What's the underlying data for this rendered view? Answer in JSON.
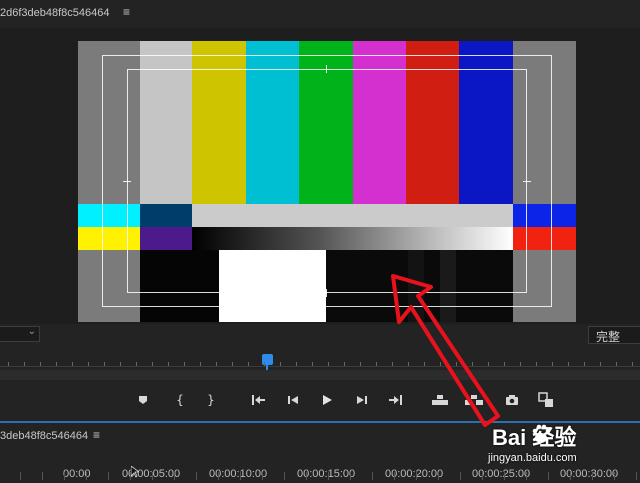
{
  "program_monitor": {
    "sequence_title": "2d6f3deb48f8c546464",
    "menu_icon": "menu-icon",
    "quality": "完整",
    "zoom_select_icon": "chevron-down-icon"
  },
  "colors": {
    "bars_top": [
      "#c5c5c5",
      "#cec400",
      "#00bfd2",
      "#00b31a",
      "#d42fcf",
      "#d01e13",
      "#0b17c4"
    ],
    "accent": "#2d8ceb",
    "annotation_arrow": "#e8121d"
  },
  "transport": {
    "buttons": [
      "add-marker-icon",
      "mark-in-icon",
      "mark-out-icon",
      "go-to-in-icon",
      "step-back-icon",
      "play-icon",
      "step-forward-icon",
      "go-to-out-icon",
      "lift-icon",
      "extract-icon",
      "export-frame-icon",
      "compare-icon"
    ]
  },
  "timeline": {
    "sequence_title": "3deb48f8c546464",
    "timecodes": [
      "00:00",
      "00:00:05:00",
      "00:00:10:00",
      "00:00:15:00",
      "00:00:20:00",
      "00:00:25:00",
      "00:00:30:00"
    ]
  },
  "watermark": {
    "brand": "Bai  经验",
    "url": "jingyan.baidu.com"
  }
}
